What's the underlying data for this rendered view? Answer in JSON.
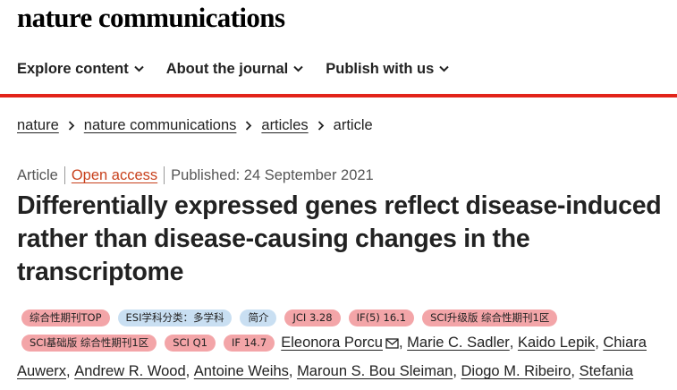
{
  "header": {
    "logo": "nature communications"
  },
  "nav": {
    "items": [
      {
        "label": "Explore content"
      },
      {
        "label": "About the journal"
      },
      {
        "label": "Publish with us"
      }
    ]
  },
  "breadcrumb": [
    "nature",
    "nature communications",
    "articles",
    "article"
  ],
  "meta": {
    "type": "Article",
    "access": "Open access",
    "published": "Published: 24 September 2021"
  },
  "title": "Differentially expressed genes reflect disease-induced rather than disease-causing changes in the transcriptome",
  "tags": [
    {
      "label": "综合性期刊TOP",
      "color": "red"
    },
    {
      "label": "ESI学科分类：多学科",
      "color": "blue"
    },
    {
      "label": "简介",
      "color": "blue"
    },
    {
      "label": "JCI 3.28",
      "color": "red"
    },
    {
      "label": "IF(5) 16.1",
      "color": "red"
    },
    {
      "label": "SCI升级版 综合性期刊1区",
      "color": "red"
    },
    {
      "label": "SCI基础版 综合性期刊1区",
      "color": "red"
    },
    {
      "label": "SCI Q1",
      "color": "red"
    },
    {
      "label": "IF 14.7",
      "color": "red"
    }
  ],
  "authors_row1": [
    "Eleonora Porcu",
    "Marie C. Sadler",
    "Kaido Lepik",
    "Chiara"
  ],
  "authors_row2": [
    "Auwerx",
    "Andrew R. Wood",
    "Antoine Weihs",
    "Maroun S. Bou Sleiman",
    "Diogo M. Ribeiro",
    "Stefania"
  ],
  "colors": {
    "accent_bar": "#e2231a",
    "open_access": "#c8401c",
    "tag_red": "#f3a5a8",
    "tag_blue": "#c9dff2"
  }
}
